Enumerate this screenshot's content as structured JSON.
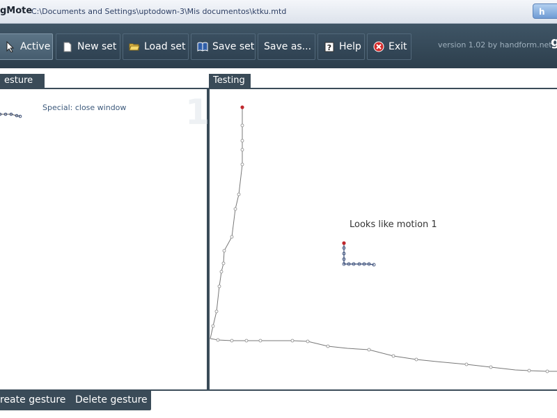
{
  "window": {
    "app_name": "gMote",
    "path": "C:\\Documents and Settings\\uptodown-3\\Mis documentos\\ktku.mtd",
    "corner_button": "h"
  },
  "toolbar": {
    "active_label": "Active",
    "new_set_label": "New set",
    "load_set_label": "Load set",
    "save_set_label": "Save set",
    "save_as_label": "Save as...",
    "help_label": "Help",
    "exit_label": "Exit",
    "version": "version 1.02 by handform.net",
    "logo": "g"
  },
  "left_panel": {
    "tab_label": "esture set",
    "gesture_description": "Special: close window",
    "gesture_number": "1"
  },
  "right_panel": {
    "tab_label": "Testing",
    "result_text": "Looks like motion 1"
  },
  "bottom": {
    "create_label": "reate gesture",
    "delete_label": "Delete gesture"
  },
  "colors": {
    "toolbar_bg": "#34495a",
    "panel_dark": "#3a4b58",
    "start_point": "#c0282d",
    "stroke_point": "#3b4f7a"
  }
}
